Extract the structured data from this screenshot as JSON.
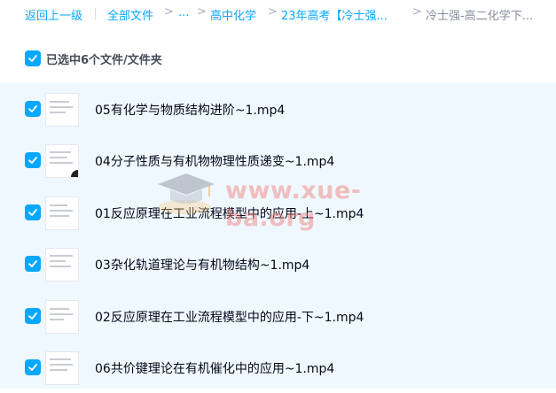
{
  "breadcrumb": {
    "back": "返回上一级",
    "items": [
      "全部文件",
      "...",
      "高中化学",
      "23年高考【冷士强...",
      "冷士强-高二化学下..."
    ],
    "separator": ">"
  },
  "selection": {
    "text": "已选中6个文件/文件夹"
  },
  "files": [
    {
      "name": "05有化学与物质结构进阶~1.mp4"
    },
    {
      "name": "04分子性质与有机物物理性质递变~1.mp4"
    },
    {
      "name": "01反应原理在工业流程模型中的应用-上~1.mp4"
    },
    {
      "name": "03杂化轨道理论与有机物结构~1.mp4"
    },
    {
      "name": "02反应原理在工业流程模型中的应用-下~1.mp4"
    },
    {
      "name": "06共价键理论在有机催化中的应用~1.mp4"
    }
  ],
  "watermark": {
    "text": "www.xue-ba.org"
  },
  "colors": {
    "accent": "#06a7ff",
    "list_bg": "#f0f8ff",
    "text": "#03081a"
  }
}
